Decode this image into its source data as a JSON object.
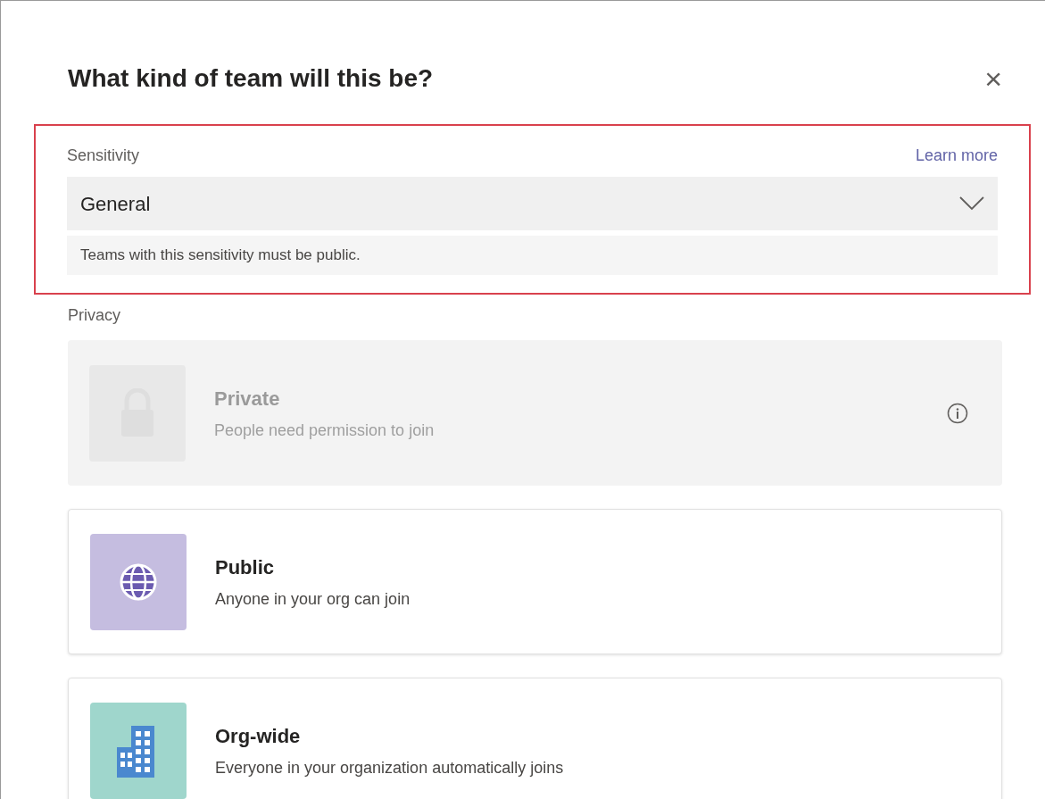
{
  "dialog": {
    "title": "What kind of team will this be?",
    "close": "×"
  },
  "sensitivity": {
    "label": "Sensitivity",
    "link": "Learn more",
    "value": "General",
    "note": "Teams with this sensitivity must be public."
  },
  "privacy": {
    "label": "Privacy",
    "options": [
      {
        "kind": "lock",
        "title": "Private",
        "description": "People need permission to join",
        "disabled": true,
        "info": true
      },
      {
        "kind": "globe",
        "title": "Public",
        "description": "Anyone in your org can join",
        "disabled": false,
        "info": false
      },
      {
        "kind": "building",
        "title": "Org-wide",
        "description": "Everyone in your organization automatically joins",
        "disabled": false,
        "info": false
      }
    ]
  }
}
